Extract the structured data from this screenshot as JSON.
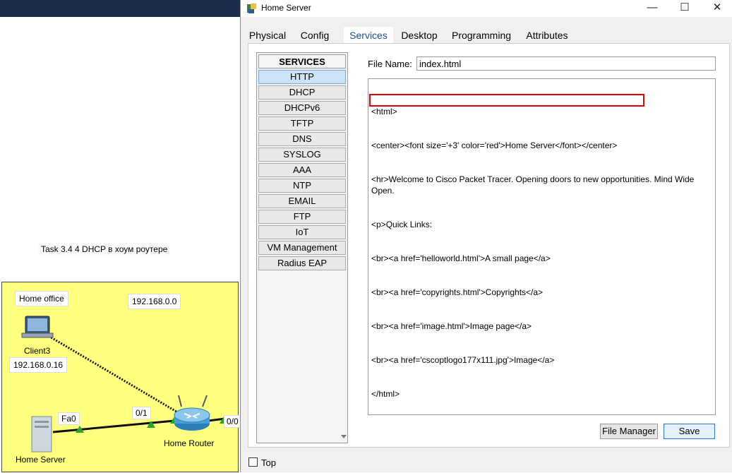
{
  "workspace": {
    "task_note": "Task 3.4 4 DHCP в хоум роутере",
    "home_office_label": "Home office",
    "network_label": "192.168.0.0",
    "client": {
      "name": "Client3",
      "ip": "192.168.0.16"
    },
    "server": {
      "name": "Home Server",
      "port": "Fa0"
    },
    "router": {
      "name": "Home Router",
      "port_left": "0/1",
      "port_right": "0/0"
    },
    "colors": {
      "area": "#ffff80",
      "link_ok": "#2aa52a"
    }
  },
  "window": {
    "title": "Home Server",
    "controls": {
      "minimize": "—",
      "maximize": "☐",
      "close": "✕"
    },
    "tabs": [
      "Physical",
      "Config",
      "Services",
      "Desktop",
      "Programming",
      "Attributes"
    ],
    "active_tab": "Services",
    "services": {
      "header": "SERVICES",
      "items": [
        "HTTP",
        "DHCP",
        "DHCPv6",
        "TFTP",
        "DNS",
        "SYSLOG",
        "AAA",
        "NTP",
        "EMAIL",
        "FTP",
        "IoT",
        "VM Management",
        "Radius EAP"
      ],
      "selected": "HTTP"
    },
    "http": {
      "file_name_label": "File Name:",
      "file_name": "index.html",
      "content_lines": [
        "<html>",
        "<center><font size='+3' color='red'>Home Server</font></center>",
        "<hr>Welcome to Cisco Packet Tracer. Opening doors to new opportunities. Mind Wide Open.",
        "<p>Quick Links:",
        "<br><a href='helloworld.html'>A small page</a>",
        "<br><a href='copyrights.html'>Copyrights</a>",
        "<br><a href='image.html'>Image page</a>",
        "<br><a href='cscoptlogo177x111.jpg'>Image</a>",
        "</html>"
      ],
      "file_manager_label": "File Manager",
      "save_label": "Save"
    },
    "top_label": "Top",
    "colors": {
      "highlight": "#e00000",
      "accent": "#2b78d4"
    }
  }
}
